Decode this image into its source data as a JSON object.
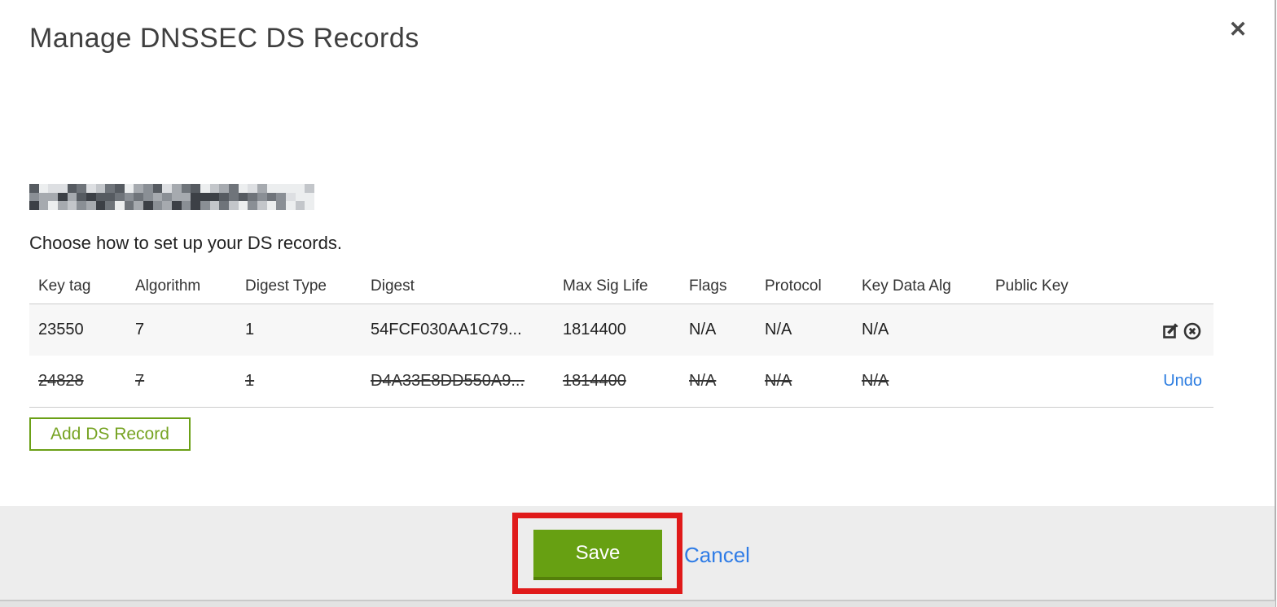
{
  "modal": {
    "title": "Manage DNSSEC DS Records",
    "close_icon": "✕",
    "domain": {
      "redacted": true
    },
    "subtitle": "Choose how to set up your DS records."
  },
  "table": {
    "headers": [
      "Key tag",
      "Algorithm",
      "Digest Type",
      "Digest",
      "Max Sig Life",
      "Flags",
      "Protocol",
      "Key Data Alg",
      "Public Key"
    ],
    "rows": [
      {
        "cells": [
          "23550",
          "7",
          "1",
          "54FCF030AA1C79...",
          "1814400",
          "N/A",
          "N/A",
          "N/A",
          ""
        ],
        "deleted": false,
        "actions": [
          "edit",
          "delete"
        ]
      },
      {
        "cells": [
          "24828",
          "7",
          "1",
          "D4A33E8DD550A9...",
          "1814400",
          "N/A",
          "N/A",
          "N/A",
          ""
        ],
        "deleted": true,
        "undo_label": "Undo"
      }
    ]
  },
  "buttons": {
    "add_ds_record": "Add DS Record",
    "save": "Save",
    "cancel": "Cancel"
  },
  "colors": {
    "save_green": "#67a012",
    "save_green_dark": "#54800a",
    "add_border_green": "#6ba016",
    "add_text_green": "#76a322",
    "link_blue": "#2b7ce0",
    "annotation_red": "#e01a1a",
    "footer_gray": "#ededed",
    "row_shade": "#f7f7f7"
  }
}
